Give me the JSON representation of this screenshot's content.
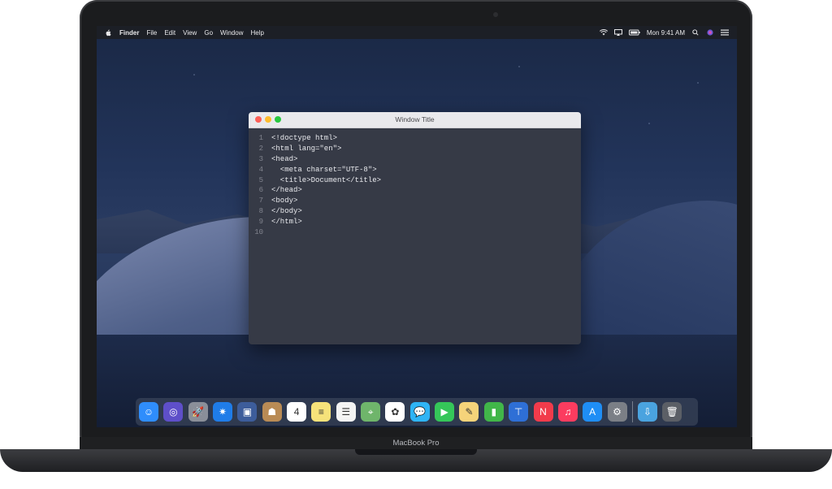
{
  "menubar": {
    "apple_icon": "apple-logo-icon",
    "items": [
      "Finder",
      "File",
      "Edit",
      "View",
      "Go",
      "Window",
      "Help"
    ],
    "status_icons": [
      "wifi-icon",
      "airplay-icon",
      "battery-icon"
    ],
    "clock": "Mon 9:41 AM",
    "right_icons": [
      "spotlight-icon",
      "siri-icon",
      "notification-center-icon"
    ]
  },
  "window": {
    "title": "Window Title",
    "lines": [
      {
        "num": "1",
        "text": "<!doctype html>"
      },
      {
        "num": "2",
        "text": "<html lang=\"en\">"
      },
      {
        "num": "3",
        "text": "<head>"
      },
      {
        "num": "4",
        "text": "  <meta charset=\"UTF-8\">"
      },
      {
        "num": "5",
        "text": "  <title>Document</title>"
      },
      {
        "num": "6",
        "text": "</head>"
      },
      {
        "num": "7",
        "text": "<body>"
      },
      {
        "num": "8",
        "text": "</body>"
      },
      {
        "num": "9",
        "text": "</html>"
      },
      {
        "num": "10",
        "text": ""
      }
    ]
  },
  "dock": {
    "apps": [
      {
        "name": "finder",
        "color": "#2f8dfc",
        "glyph": "☺"
      },
      {
        "name": "siri",
        "color": "#5e4fc9",
        "glyph": "◎"
      },
      {
        "name": "launchpad",
        "color": "#8a8f99",
        "glyph": "🚀"
      },
      {
        "name": "safari",
        "color": "#1f7ce8",
        "glyph": "✷"
      },
      {
        "name": "photos-slideshow",
        "color": "#3d5d9b",
        "glyph": "▣"
      },
      {
        "name": "contacts",
        "color": "#b98b55",
        "glyph": "☗"
      },
      {
        "name": "calendar",
        "color": "#ffffff",
        "glyph": "4"
      },
      {
        "name": "notes",
        "color": "#f6e27a",
        "glyph": "≡"
      },
      {
        "name": "reminders",
        "color": "#f4f4f4",
        "glyph": "☰"
      },
      {
        "name": "maps",
        "color": "#6fb56b",
        "glyph": "⌖"
      },
      {
        "name": "photos",
        "color": "#ffffff",
        "glyph": "✿"
      },
      {
        "name": "messages",
        "color": "#2fb4f5",
        "glyph": "💬"
      },
      {
        "name": "facetime",
        "color": "#35c659",
        "glyph": "▶"
      },
      {
        "name": "freeform",
        "color": "#f5d37a",
        "glyph": "✎"
      },
      {
        "name": "numbers",
        "color": "#41b649",
        "glyph": "▮"
      },
      {
        "name": "keynote",
        "color": "#2e6fd6",
        "glyph": "⊤"
      },
      {
        "name": "news",
        "color": "#f23b4b",
        "glyph": "N"
      },
      {
        "name": "music",
        "color": "#fc3c5f",
        "glyph": "♫"
      },
      {
        "name": "app-store",
        "color": "#1f8ef5",
        "glyph": "A"
      },
      {
        "name": "system-preferences",
        "color": "#7b7f86",
        "glyph": "⚙"
      }
    ],
    "trailing": [
      {
        "name": "downloads-folder",
        "color": "#4aa3df",
        "glyph": "⇩"
      },
      {
        "name": "trash",
        "color": "#5b5f66",
        "glyph": "🗑"
      }
    ]
  },
  "device": {
    "label": "MacBook Pro"
  }
}
